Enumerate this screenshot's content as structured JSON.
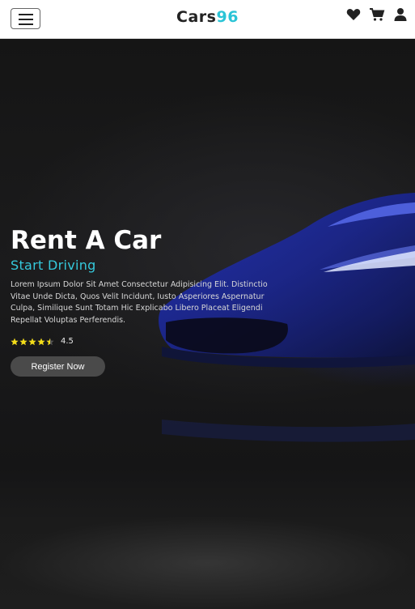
{
  "navbar": {
    "brand_part1": "Cars",
    "brand_part2": "96",
    "icons": [
      "menu-icon",
      "heart-icon",
      "cart-icon",
      "user-icon"
    ]
  },
  "hero": {
    "title": "Rent A Car",
    "subtitle": "Start Driving",
    "description": "Lorem Ipsum Dolor Sit Amet Consectetur Adipisicing Elit. Distinctio Vitae Unde Dicta, Quos Velit Incidunt, Iusto Asperiores Aspernatur Culpa, Similique Sunt Totam Hic Explicabo Libero Placeat Eligendi Repellat Voluptas Perferendis.",
    "rating": {
      "stars": 4.5,
      "max": 5,
      "value_text": "4.5"
    },
    "register_label": "Register Now"
  },
  "colors": {
    "accent": "#2bc4d6",
    "star": "#f2dc1a",
    "car_blue": "#1d2fb8"
  }
}
